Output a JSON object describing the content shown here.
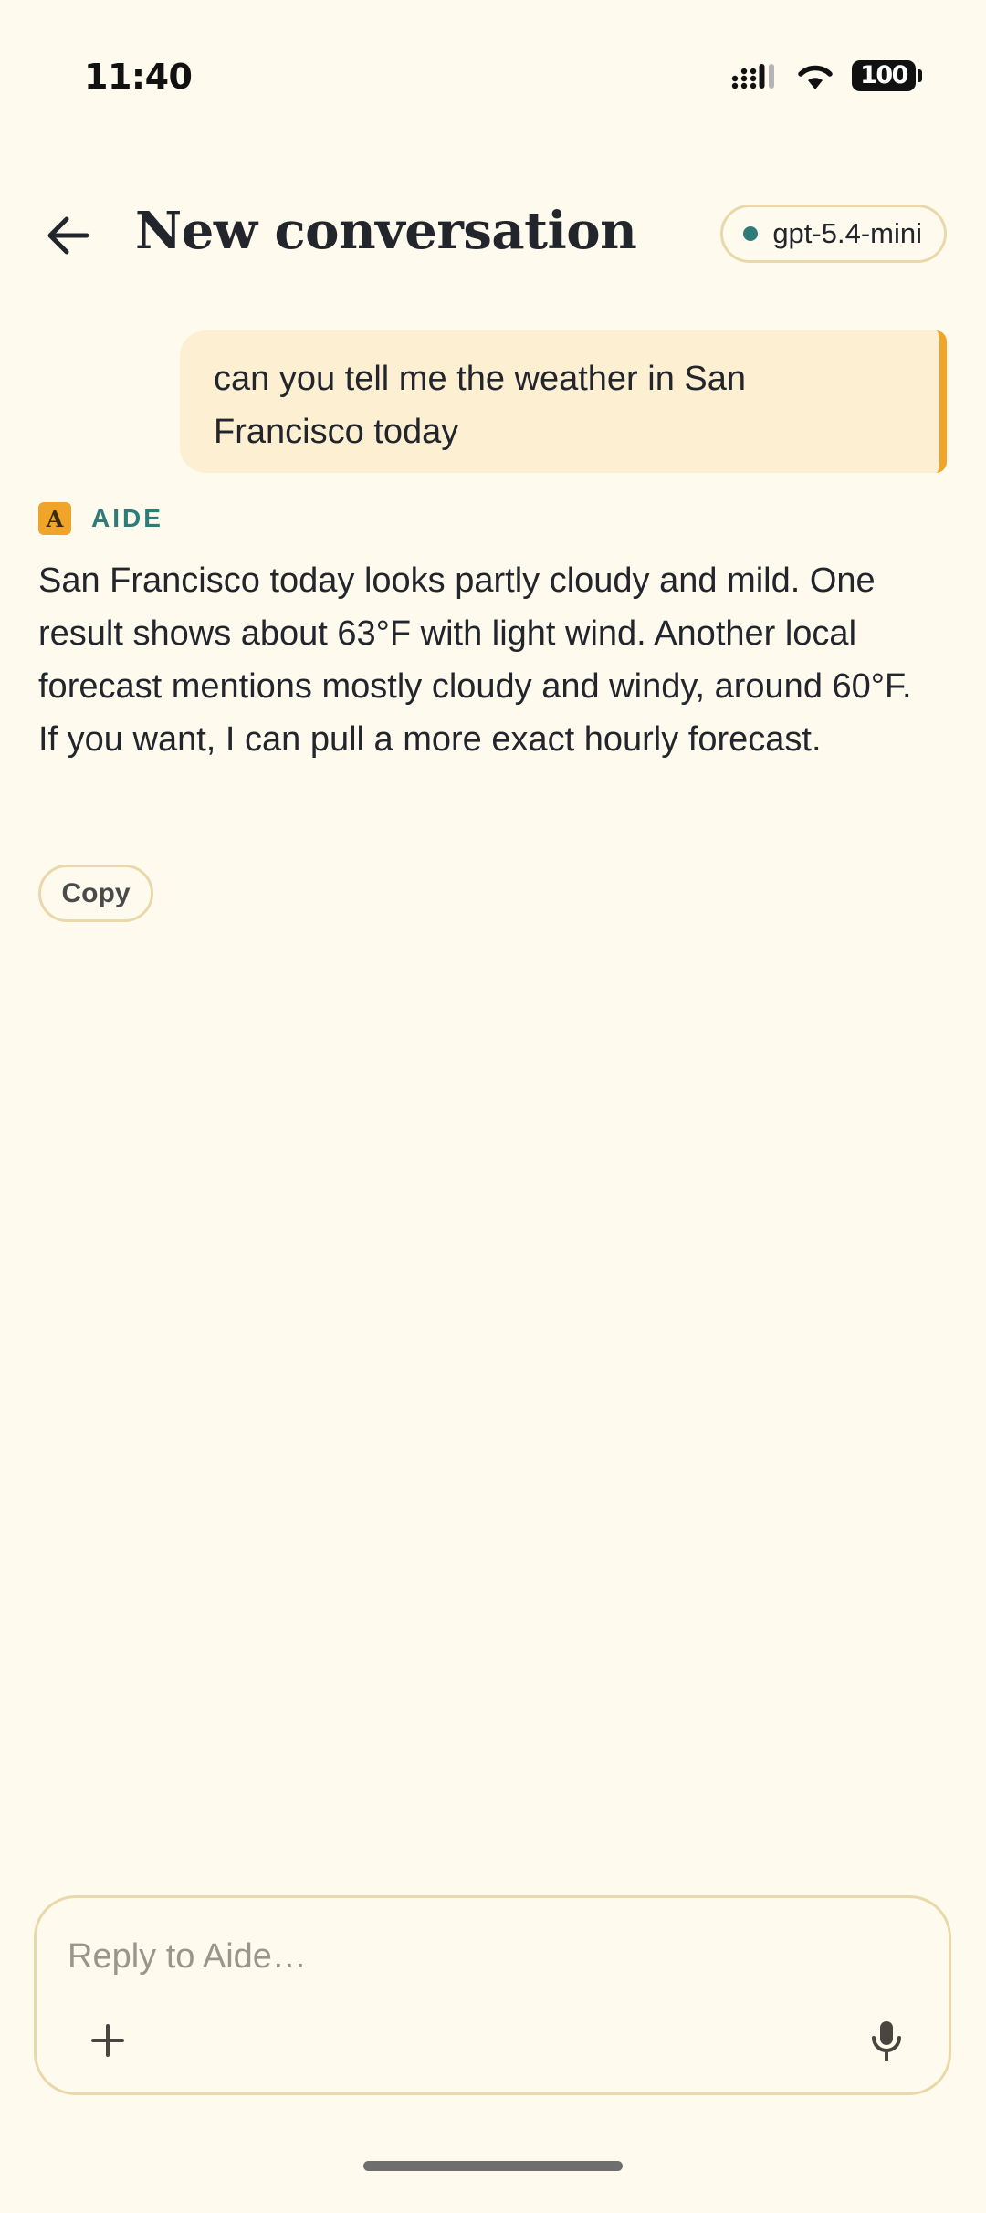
{
  "status_bar": {
    "time": "11:40",
    "battery": "100"
  },
  "header": {
    "back_icon": "arrow-left-icon",
    "title": "New conversation",
    "model": "gpt-5.4-mini",
    "model_status_color": "#2e7c7a"
  },
  "messages": {
    "user": "can you tell me the weather in San Francisco today",
    "assistant": {
      "avatar_letter": "A",
      "name": "AIDE",
      "paragraph_1": "San Francisco today looks partly cloudy and mild. One result shows about 63°F with light wind. Another local forecast mentions mostly cloudy and windy, around 60°F.",
      "paragraph_2": "If you want, I can pull a more exact hourly forecast.",
      "copy_label": "Copy"
    }
  },
  "composer": {
    "placeholder": "Reply to Aide…",
    "add_icon": "plus-icon",
    "mic_icon": "microphone-icon"
  },
  "colors": {
    "background": "#fffaee",
    "accent": "#f0a52a",
    "teal": "#2e7c7a",
    "user_bubble": "#fdefd2",
    "border": "#e9d8a9"
  }
}
